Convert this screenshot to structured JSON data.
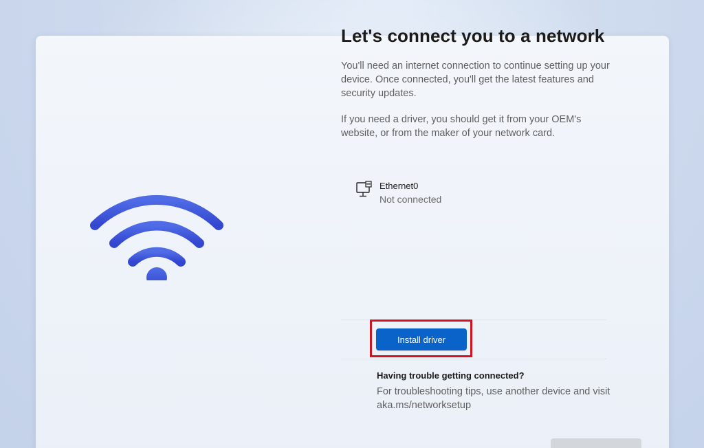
{
  "title": "Let's connect you to a network",
  "description_1": "You'll need an internet connection to continue setting up your device. Once connected, you'll get the latest features and security updates.",
  "description_2": "If you need a driver, you should get it from your OEM's website, or from the maker of your network card.",
  "network": {
    "icon": "ethernet-icon",
    "name": "Ethernet0",
    "status": "Not connected"
  },
  "actions": {
    "install_driver_label": "Install driver",
    "next_label": ""
  },
  "help": {
    "heading": "Having trouble getting connected?",
    "text": "For troubleshooting tips, use another device and visit aka.ms/networksetup"
  },
  "illustration": {
    "icon": "wifi-icon",
    "color": "#3b55d9"
  },
  "colors": {
    "accent": "#0a63c9",
    "highlight": "#d1121f"
  }
}
